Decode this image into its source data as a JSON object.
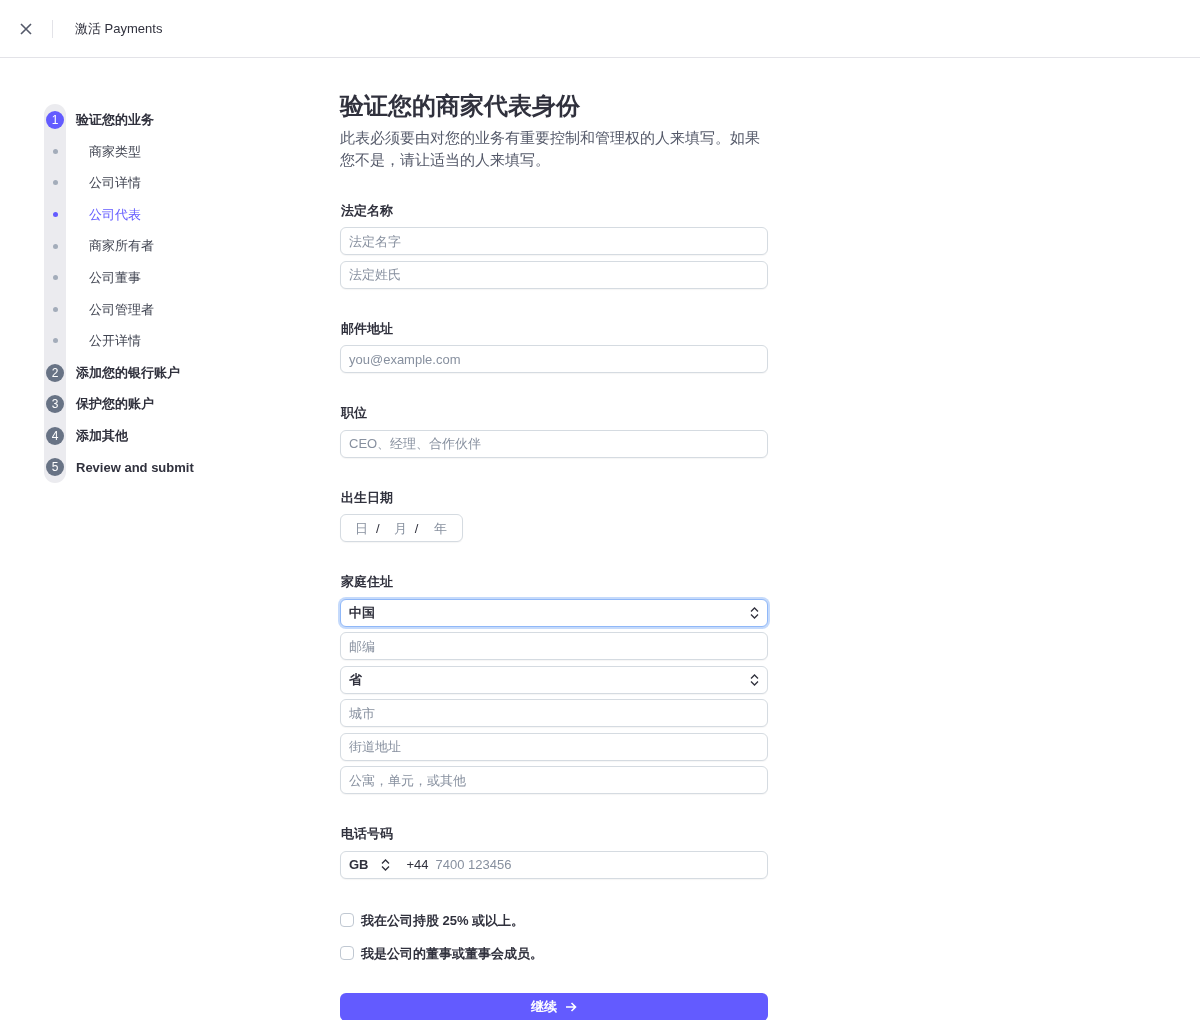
{
  "header": {
    "title": "激活 Payments"
  },
  "steps": [
    {
      "number": "1",
      "label": "验证您的业务",
      "selected": true,
      "children": [
        {
          "label": "商家类型",
          "selected": false
        },
        {
          "label": "公司详情",
          "selected": false
        },
        {
          "label": "公司代表",
          "selected": true
        },
        {
          "label": "商家所有者",
          "selected": false
        },
        {
          "label": "公司董事",
          "selected": false
        },
        {
          "label": "公司管理者",
          "selected": false
        },
        {
          "label": "公开详情",
          "selected": false
        }
      ]
    },
    {
      "number": "2",
      "label": "添加您的银行账户",
      "selected": false
    },
    {
      "number": "3",
      "label": "保护您的账户",
      "selected": false
    },
    {
      "number": "4",
      "label": "添加其他",
      "selected": false
    },
    {
      "number": "5",
      "label": "Review and submit",
      "selected": false
    }
  ],
  "form": {
    "title": "验证您的商家代表身份",
    "description": "此表必须要由对您的业务有重要控制和管理权的人来填写。如果您不是，请让适当的人来填写。",
    "sections": [
      {
        "label": "法定名称",
        "fields": [
          {
            "kind": "text",
            "placeholder": "法定名字"
          },
          {
            "kind": "text",
            "placeholder": "法定姓氏"
          }
        ]
      },
      {
        "label": "邮件地址",
        "fields": [
          {
            "kind": "text",
            "placeholder": "you@example.com"
          }
        ]
      },
      {
        "label": "职位",
        "fields": [
          {
            "kind": "text",
            "placeholder": "CEO、经理、合作伙伴"
          }
        ]
      },
      {
        "label": "出生日期",
        "fields": [
          {
            "kind": "date",
            "parts": [
              "日",
              "月",
              "年"
            ],
            "separator": "/"
          }
        ]
      },
      {
        "label": "家庭住址",
        "fields": [
          {
            "kind": "select",
            "value": "中国",
            "focused": true
          },
          {
            "kind": "text",
            "placeholder": "邮编"
          },
          {
            "kind": "select",
            "value": "省",
            "focused": false
          },
          {
            "kind": "text",
            "placeholder": "城市"
          },
          {
            "kind": "text",
            "placeholder": "街道地址"
          },
          {
            "kind": "text",
            "placeholder": "公寓，单元，或其他"
          }
        ]
      },
      {
        "label": "电话号码",
        "fields": [
          {
            "kind": "phone",
            "country": "GB",
            "prefix": "+44",
            "placeholder": "7400 123456"
          }
        ]
      }
    ],
    "checkboxes": [
      {
        "label": "我在公司持股 25% 或以上。",
        "checked": false
      },
      {
        "label": "我是公司的董事或董事会成员。",
        "checked": false
      }
    ],
    "submit": "继续"
  }
}
